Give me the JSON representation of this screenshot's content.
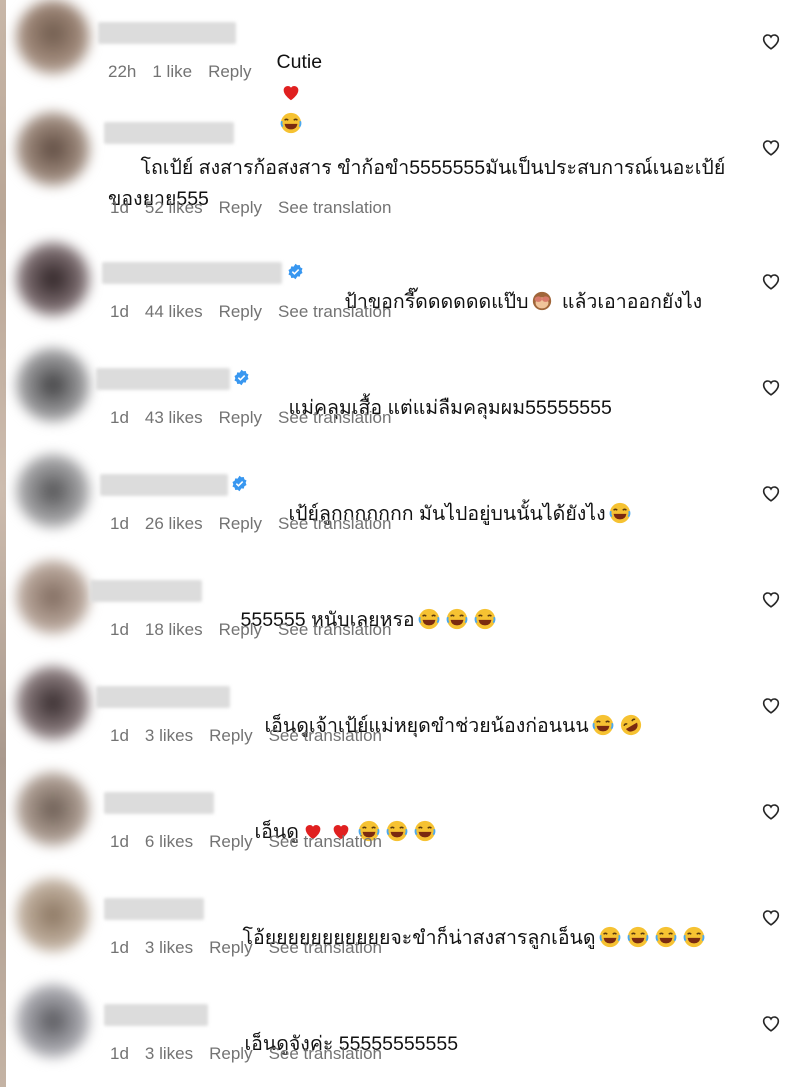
{
  "comments": [
    {
      "text": "Cutie",
      "emojis": [
        "red-heart",
        "joy"
      ],
      "time": "22h",
      "likes": "1 like",
      "reply": "Reply",
      "translation": "",
      "verified": false
    },
    {
      "text": "โถเป้ย์ สงสารก้อสงสาร ขำก้อขำ5555555มันเป็นประสบการณ์เนอะเป้ย์ของยาย555",
      "emojis": [],
      "time": "1d",
      "likes": "52 likes",
      "reply": "Reply",
      "translation": "See translation",
      "verified": false
    },
    {
      "text": "ป้าขอกรี๊ดดดดดดแป๊บ",
      "text2": " แล้วเอาออกยังไง",
      "emojis": [
        "see-no-evil-monkey"
      ],
      "time": "1d",
      "likes": "44 likes",
      "reply": "Reply",
      "translation": "See translation",
      "verified": true
    },
    {
      "text": "แม่คลุมเสื้อ แต่แม่ลืมคลุมผม55555555",
      "emojis": [],
      "time": "1d",
      "likes": "43 likes",
      "reply": "Reply",
      "translation": "See translation",
      "verified": true
    },
    {
      "text": "เป้ย์ลูกกกกกกก มันไปอยู่บนนั้นได้ยังไง",
      "emojis": [
        "joy"
      ],
      "time": "1d",
      "likes": "26 likes",
      "reply": "Reply",
      "translation": "See translation",
      "verified": true
    },
    {
      "text": "555555 หนับเลยหรอ",
      "emojis": [
        "joy",
        "joy",
        "joy"
      ],
      "time": "1d",
      "likes": "18 likes",
      "reply": "Reply",
      "translation": "See translation",
      "verified": false
    },
    {
      "text": "เอ็นดูเจ้าเป้ย์แม่หยุดขำช่วยน้องก่อนนน",
      "emojis": [
        "joy",
        "rofl"
      ],
      "time": "1d",
      "likes": "3 likes",
      "reply": "Reply",
      "translation": "See translation",
      "verified": false
    },
    {
      "text": "เอ็นดู",
      "emojis": [
        "red-heart",
        "red-heart",
        "joy",
        "joy",
        "joy"
      ],
      "time": "1d",
      "likes": "6 likes",
      "reply": "Reply",
      "translation": "See translation",
      "verified": false
    },
    {
      "text": "โอ้ยยยยยยยยยยยจะขำก็น่าสงสารลูกเอ็นดู",
      "emojis": [
        "joy",
        "joy",
        "joy",
        "joy"
      ],
      "time": "1d",
      "likes": "3 likes",
      "reply": "Reply",
      "translation": "See translation",
      "verified": false
    },
    {
      "text": "เอ็นดูจังค่ะ 55555555555",
      "emojis": [],
      "time": "1d",
      "likes": "3 likes",
      "reply": "Reply",
      "translation": "See translation",
      "verified": false
    }
  ],
  "like_icon": "heart-outline-icon"
}
